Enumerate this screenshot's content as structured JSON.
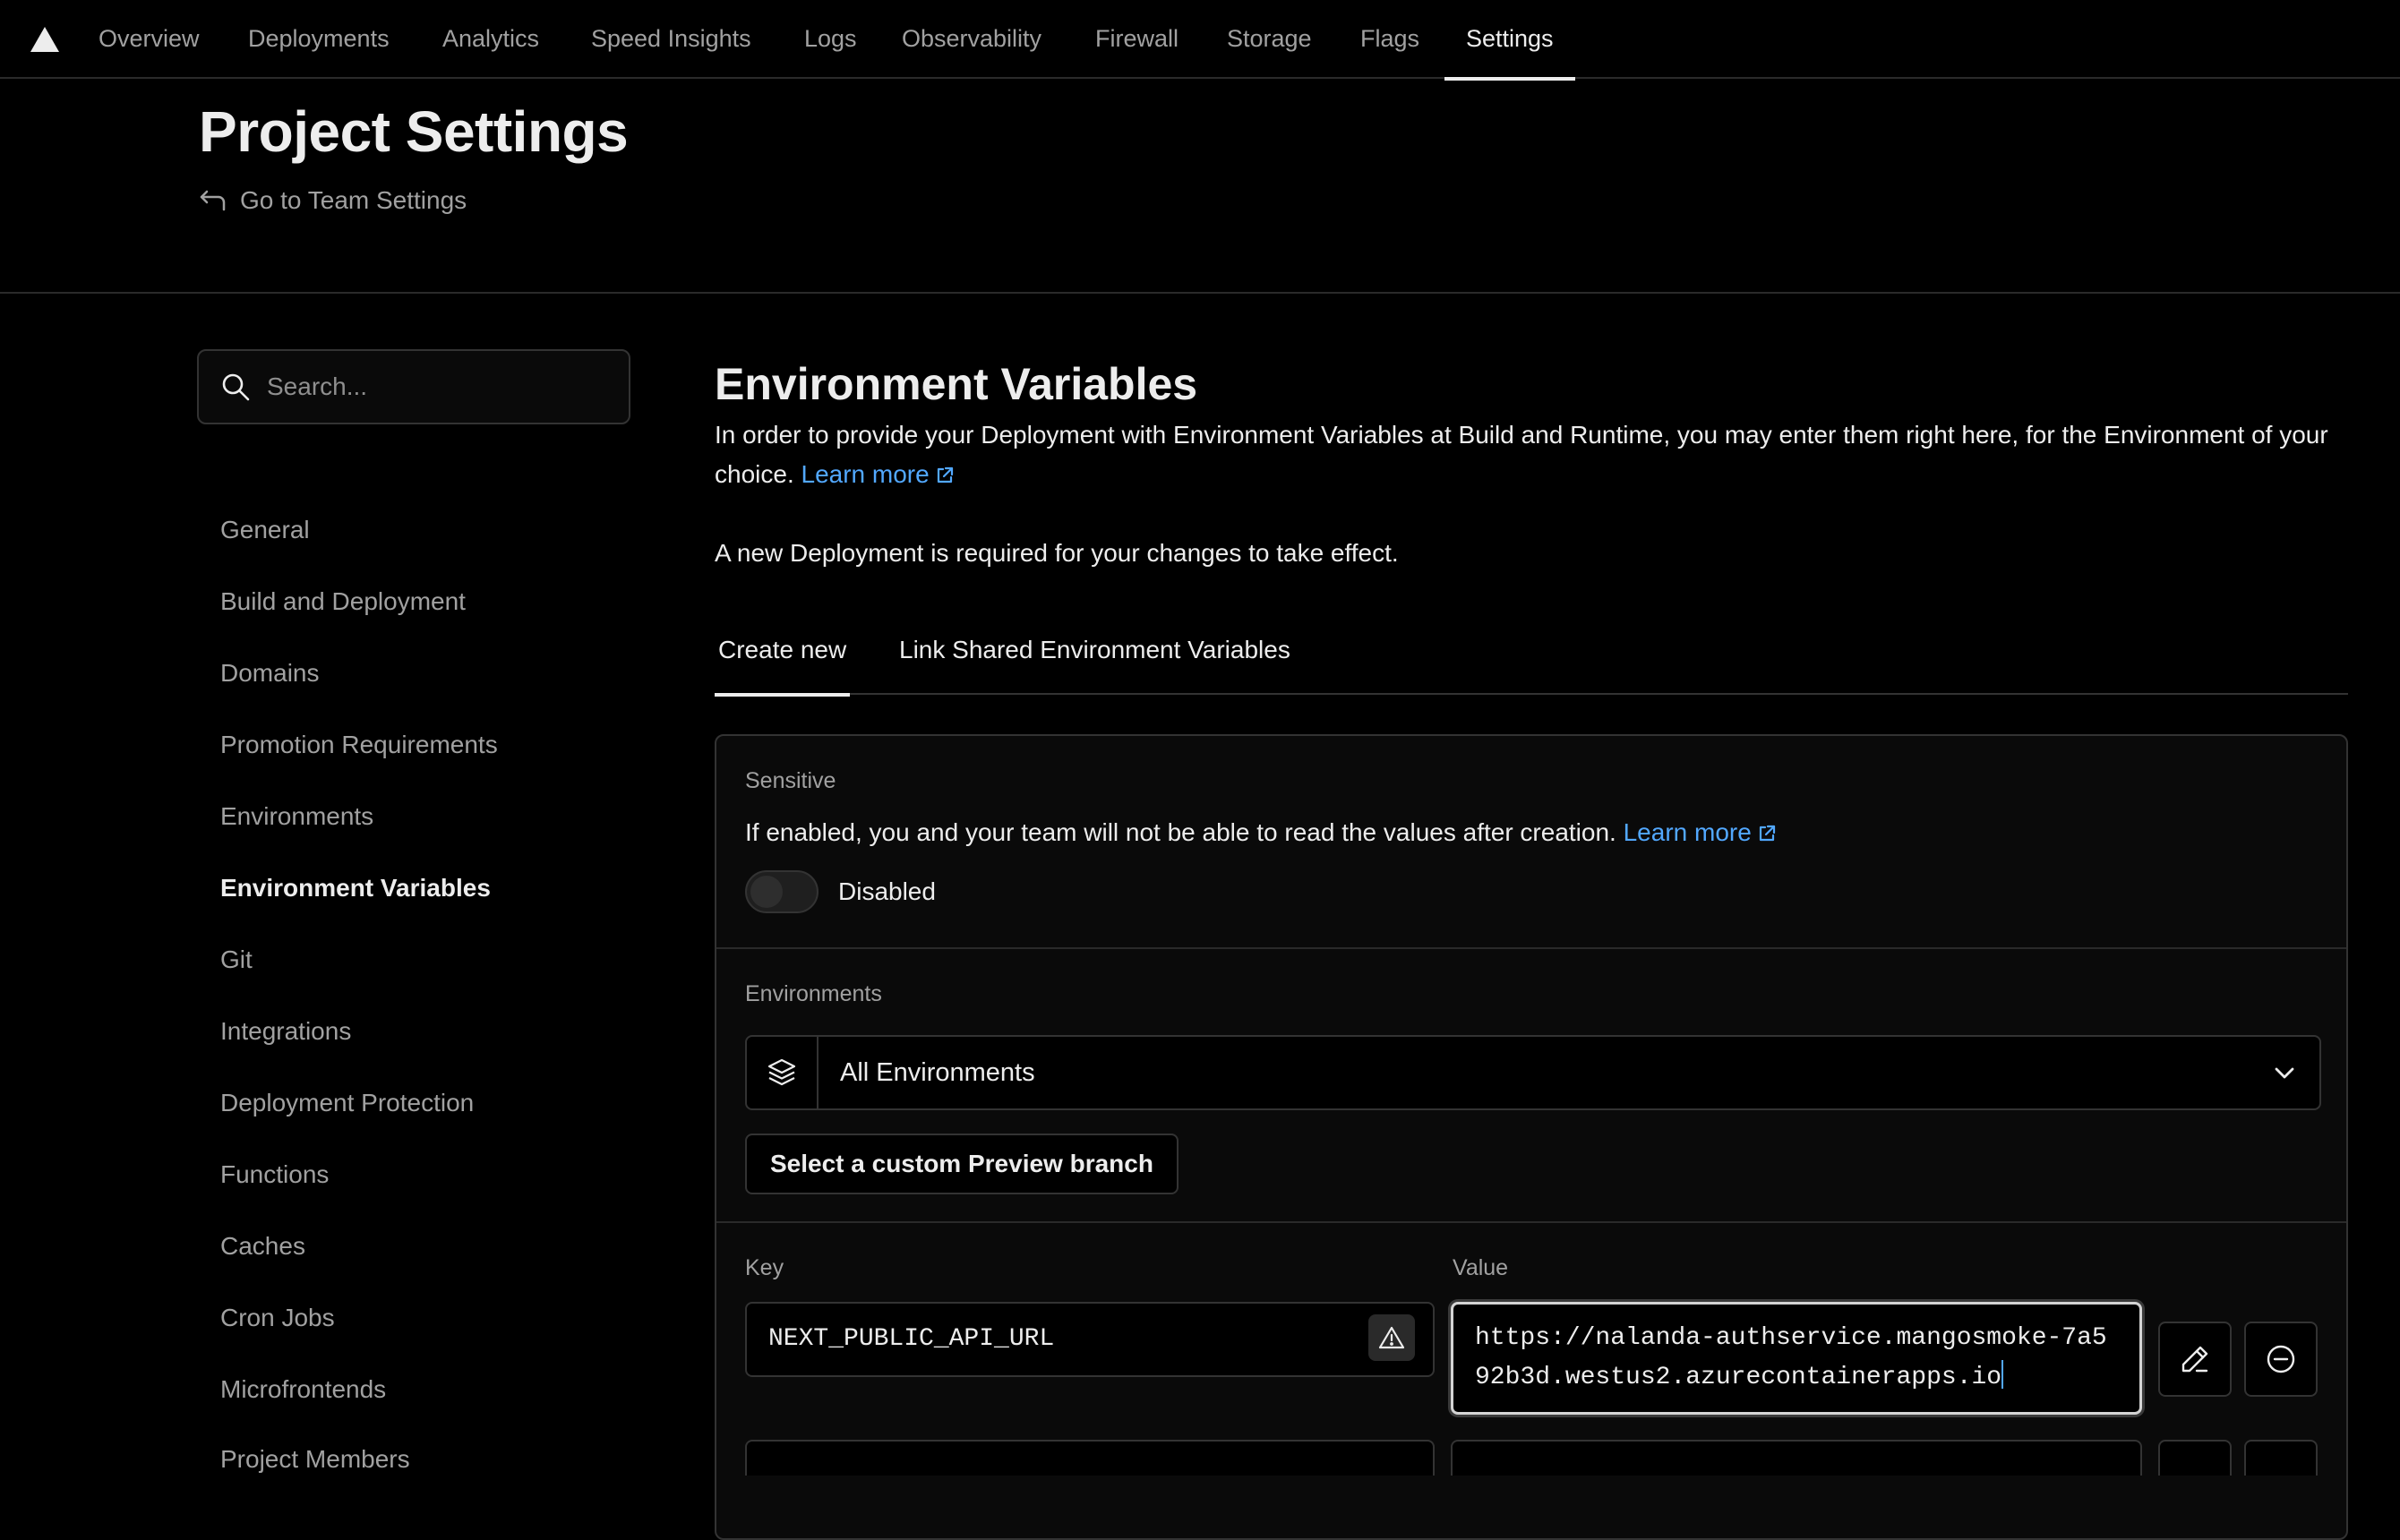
{
  "nav": {
    "tabs": [
      "Overview",
      "Deployments",
      "Analytics",
      "Speed Insights",
      "Logs",
      "Observability",
      "Firewall",
      "Storage",
      "Flags",
      "Settings"
    ],
    "active": "Settings"
  },
  "header": {
    "title": "Project Settings",
    "team_link": "Go to Team Settings"
  },
  "sidebar": {
    "search_placeholder": "Search...",
    "items": [
      "General",
      "Build and Deployment",
      "Domains",
      "Promotion Requirements",
      "Environments",
      "Environment Variables",
      "Git",
      "Integrations",
      "Deployment Protection",
      "Functions",
      "Caches",
      "Cron Jobs",
      "Microfrontends",
      "Project Members"
    ],
    "active": "Environment Variables"
  },
  "main": {
    "title": "Environment Variables",
    "description": "In order to provide your Deployment with Environment Variables at Build and Runtime, you may enter them right here, for the Environment of your choice.",
    "learn_more": "Learn more",
    "note": "A new Deployment is required for your changes to take effect.",
    "tabs": [
      "Create new",
      "Link Shared Environment Variables"
    ]
  },
  "form": {
    "sensitive_label": "Sensitive",
    "sensitive_desc": "If enabled, you and your team will not be able to read the values after creation.",
    "learn_more": "Learn more",
    "toggle_state": "Disabled",
    "environments_label": "Environments",
    "environments_value": "All Environments",
    "branch_button": "Select a custom Preview branch",
    "key_label": "Key",
    "value_label": "Value",
    "key_value": "NEXT_PUBLIC_API_URL",
    "value_value": "https://nalanda-authservice.mangosmoke-7a592b3d.westus2.azurecontainerapps.io"
  },
  "colors": {
    "background": "#000000",
    "link": "#52a8ff",
    "text": "#ededed",
    "muted": "#a1a1a1"
  }
}
